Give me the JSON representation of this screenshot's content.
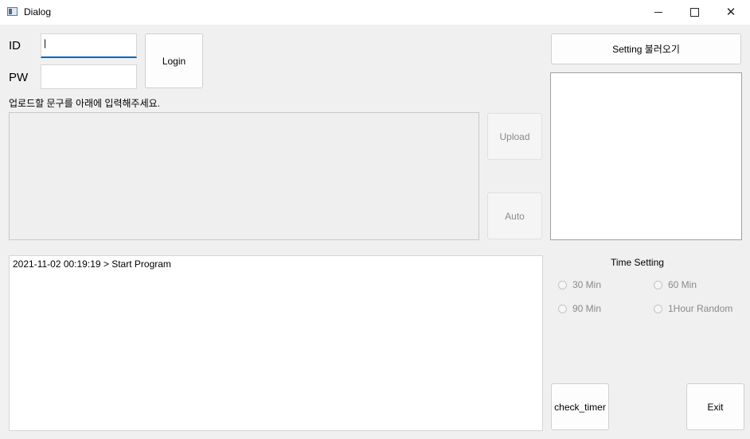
{
  "window": {
    "title": "Dialog",
    "minimize": "—",
    "maximize": "☐",
    "close": "✕"
  },
  "login": {
    "id_label": "ID",
    "pw_label": "PW",
    "id_value": "|",
    "pw_value": "",
    "login_button": "Login"
  },
  "upload": {
    "instruction": "업로드할 문구를 아래에 입력해주세요.",
    "text": "",
    "upload_button": "Upload",
    "auto_button": "Auto"
  },
  "log": {
    "lines": [
      "2021-11-02 00:19:19 > Start Program"
    ]
  },
  "settings": {
    "load_button": "Setting 불러오기",
    "time_setting_label": "Time Setting",
    "options": [
      "30 Min",
      "60 Min",
      "90 Min",
      "1Hour Random"
    ]
  },
  "bottom": {
    "check_timer_button": "check_timer",
    "exit_button": "Exit"
  }
}
